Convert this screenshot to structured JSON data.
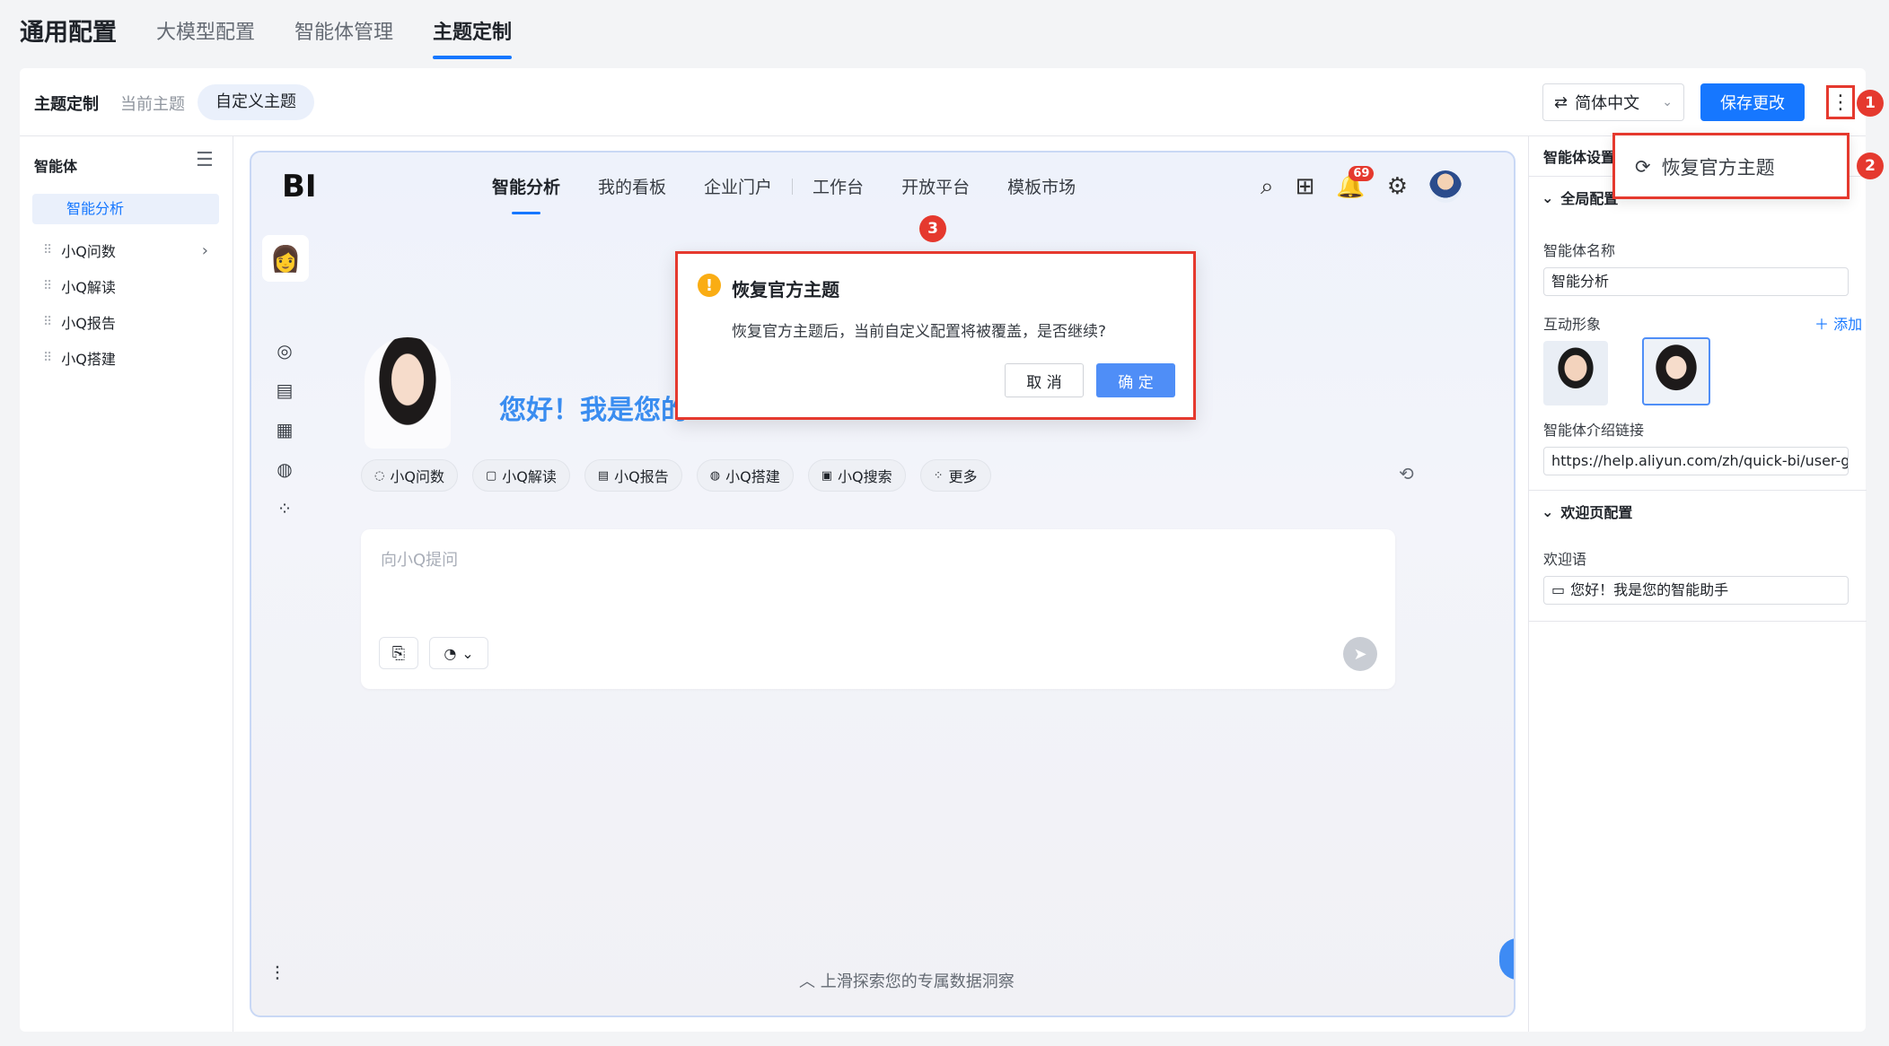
{
  "top_tabs": {
    "title": "通用配置",
    "items": [
      "大模型配置",
      "智能体管理",
      "主题定制"
    ]
  },
  "subheader": {
    "title": "主题定制",
    "current_theme": "当前主题",
    "custom_theme": "自定义主题",
    "language": "简体中文",
    "save_label": "保存更改",
    "more_icon": "⋮"
  },
  "left_sidebar": {
    "title": "智能体",
    "active_item": "智能分析",
    "items": [
      "小Q问数",
      "小Q解读",
      "小Q报告",
      "小Q搭建"
    ]
  },
  "preview": {
    "logo": "BI",
    "nav": [
      "智能分析",
      "我的看板",
      "企业门户",
      "工作台",
      "开放平台",
      "模板市场"
    ],
    "notification_count": "69",
    "greeting": "您好！我是您的",
    "chips": [
      "小Q问数",
      "小Q解读",
      "小Q报告",
      "小Q搭建",
      "小Q搜索",
      "更多"
    ],
    "input_placeholder": "向小Q提问",
    "footer": "︿ 上滑探索您的专属数据洞察"
  },
  "dialog": {
    "title": "恢复官方主题",
    "message": "恢复官方主题后，当前自定义配置将被覆盖，是否继续?",
    "cancel": "取 消",
    "ok": "确 定"
  },
  "right_panel": {
    "title": "智能体设置",
    "global_section": "全局配置",
    "name_label": "智能体名称",
    "name_value": "智能分析",
    "avatar_label": "互动形象",
    "add_label": "＋ 添加",
    "link_label": "智能体介绍链接",
    "link_value": "https://help.aliyun.com/zh/quick-bi/user-gui",
    "welcome_section": "欢迎页配置",
    "welcome_label": "欢迎语",
    "welcome_value": "您好！我是您的智能助手"
  },
  "dropdown": {
    "item": "恢复官方主题"
  },
  "annotations": [
    "1",
    "2",
    "3"
  ],
  "colors": {
    "accent": "#1677ff",
    "annotation": "#e5392e",
    "warning": "#faad14"
  }
}
